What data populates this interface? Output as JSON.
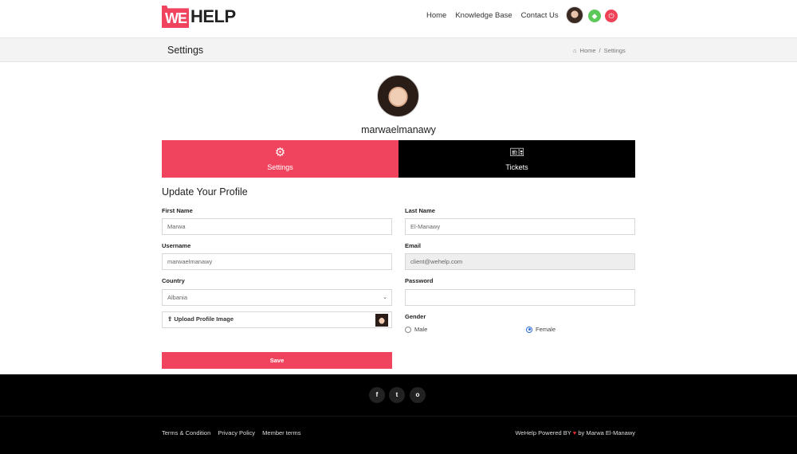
{
  "brand": {
    "logo_we": "WE",
    "logo_help": "HELP"
  },
  "nav": {
    "items": [
      "Home",
      "Knowledge Base",
      "Contact Us"
    ]
  },
  "header": {
    "green_icon": "tag-icon",
    "red_icon": "power-icon"
  },
  "titlebar": {
    "title": "Settings",
    "breadcrumb_home": "Home",
    "breadcrumb_sep": "/",
    "breadcrumb_current": "Settings"
  },
  "profile": {
    "username": "marwaelmanawy"
  },
  "tabs": {
    "settings": "Settings",
    "tickets": "Tickets"
  },
  "form": {
    "heading": "Update Your Profile",
    "first_name_label": "First Name",
    "first_name_value": "Marwa",
    "last_name_label": "Last Name",
    "last_name_value": "El-Manawy",
    "username_label": "Username",
    "username_value": "marwaelmanawy",
    "email_label": "Email",
    "email_value": "client@wehelp.com",
    "country_label": "Country",
    "country_value": "Albania",
    "password_label": "Password",
    "password_value": "",
    "upload_label": "Upload Profile Image",
    "gender_label": "Gender",
    "gender_male": "Male",
    "gender_female": "Female",
    "save_label": "Save"
  },
  "footer": {
    "links": [
      "Terms & Condition",
      "Privacy Policy",
      "Member terms"
    ],
    "powered_prefix": "WeHelp Powered BY",
    "powered_suffix": "by Marwa El-Manawy",
    "social_fb": "f",
    "social_tw": "t",
    "social_ig": "o"
  },
  "colors": {
    "accent": "#f0435d",
    "footer_bg": "#000000",
    "green": "#5dc85a"
  }
}
